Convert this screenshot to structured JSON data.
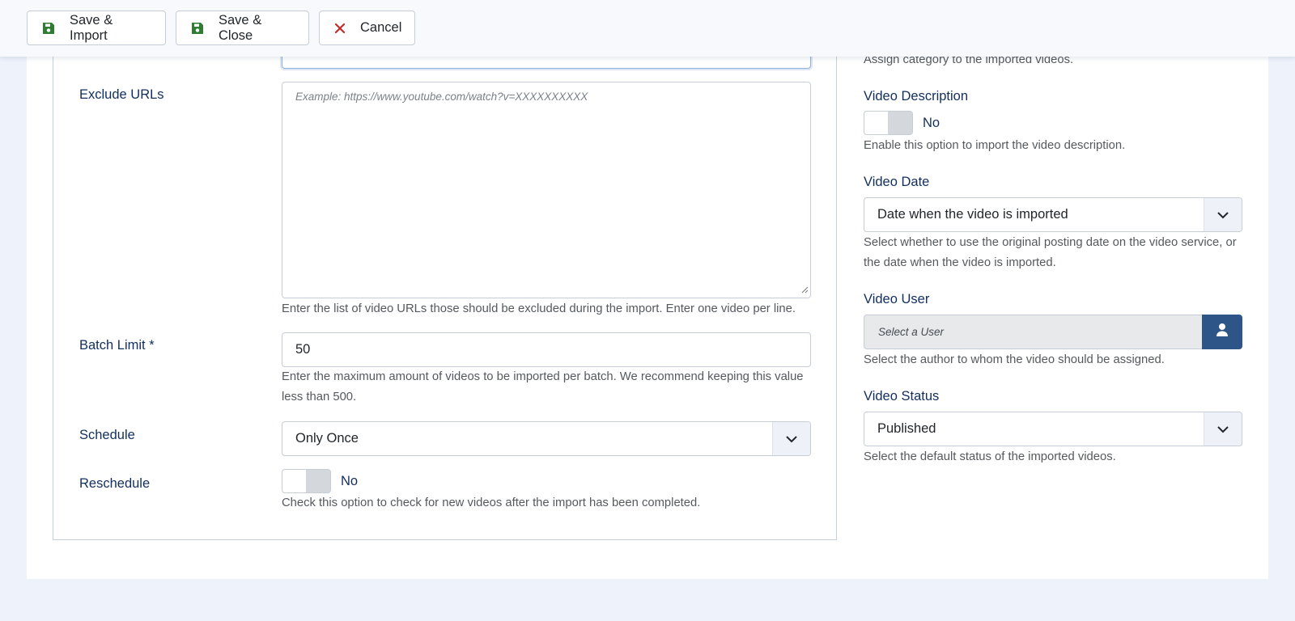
{
  "toolbar": {
    "save_import_label": "Save & Import",
    "save_close_label": "Save & Close",
    "cancel_label": "Cancel"
  },
  "left": {
    "exclude_urls": {
      "label": "Exclude URLs",
      "placeholder": "Example: https://www.youtube.com/watch?v=XXXXXXXXXX",
      "help": "Enter the list of video URLs those should be excluded during the import. Enter one video per line."
    },
    "batch_limit": {
      "label": "Batch Limit *",
      "value": "50",
      "help_line1": "Enter the maximum amount of videos to be imported per batch. We recommend keeping this value",
      "help_line2": "less than 500."
    },
    "schedule": {
      "label": "Schedule",
      "selected": "Only Once"
    },
    "reschedule": {
      "label": "Reschedule",
      "toggle_text": "No",
      "help": "Check this option to check for new videos after the import has been completed."
    }
  },
  "right": {
    "category_help": "Assign category to the imported videos.",
    "video_description": {
      "label": "Video Description",
      "toggle_text": "No",
      "help": "Enable this option to import the video description."
    },
    "video_date": {
      "label": "Video Date",
      "selected": "Date when the video is imported",
      "help_line1": "Select whether to use the original posting date on the video service, or",
      "help_line2": "the date when the video is imported."
    },
    "video_user": {
      "label": "Video User",
      "placeholder": "Select a User",
      "help": "Select the author to whom the video should be assigned."
    },
    "video_status": {
      "label": "Video Status",
      "selected": "Published",
      "help": "Select the default status of the imported videos."
    }
  },
  "colors": {
    "label": "#122e5d",
    "save_icon": "#2f7d32",
    "cancel_icon": "#c52b2b",
    "user_button": "#2e5587"
  },
  "icons": {
    "save": "floppy-disk-icon",
    "cancel": "x-icon",
    "chevron": "chevron-down-icon",
    "user": "user-icon",
    "resize": "resize-grip-icon"
  }
}
